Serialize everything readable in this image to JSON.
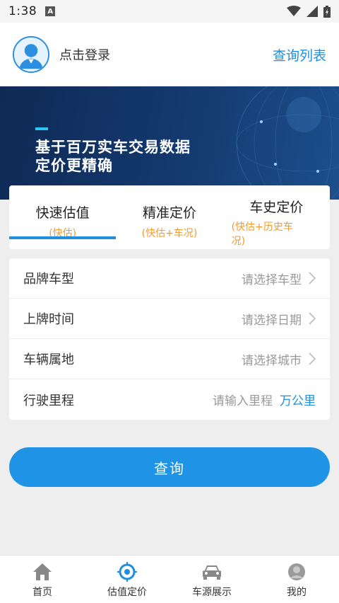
{
  "status_bar": {
    "time": "1:38",
    "notification_glyph": "A"
  },
  "header": {
    "login_label": "点击登录",
    "query_list_label": "查询列表"
  },
  "banner": {
    "line1": "基于百万实车交易数据",
    "line2": "定价更精确"
  },
  "tabs": [
    {
      "label": "快速估值",
      "sub": "(快估)",
      "active": true
    },
    {
      "label": "精准定价",
      "sub": "(快估+车况)",
      "active": false
    },
    {
      "label": "车史定价",
      "sub": "(快估+历史车况)",
      "active": false
    }
  ],
  "form": {
    "brand": {
      "label": "品牌车型",
      "placeholder": "请选择车型"
    },
    "plate_date": {
      "label": "上牌时间",
      "placeholder": "请选择日期"
    },
    "location": {
      "label": "车辆属地",
      "placeholder": "请选择城市"
    },
    "mileage": {
      "label": "行驶里程",
      "placeholder": "请输入里程",
      "unit": "万公里"
    }
  },
  "query_button": "查询",
  "bottom_nav": [
    {
      "label": "首页",
      "icon": "home-icon"
    },
    {
      "label": "估值定价",
      "icon": "target-icon",
      "active": true
    },
    {
      "label": "车源展示",
      "icon": "car-icon"
    },
    {
      "label": "我的",
      "icon": "profile-icon"
    }
  ],
  "colors": {
    "accent": "#1f8ee0",
    "orange": "#f39a2b",
    "banner": "#143a70"
  }
}
